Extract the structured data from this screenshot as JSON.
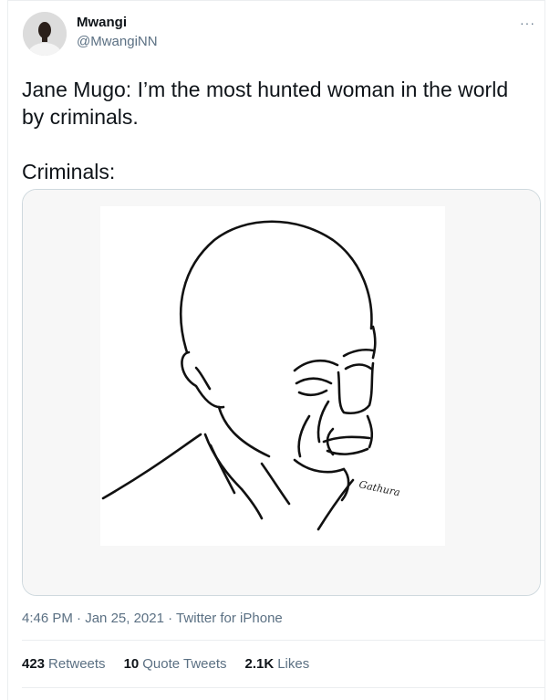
{
  "user": {
    "name": "Mwangi",
    "handle": "@MwangiNN"
  },
  "more_label": "···",
  "tweet": {
    "text": "Jane Mugo: I’m the most hunted woman in the world by criminals.\n\nCriminals:",
    "image_signature": "Gathura"
  },
  "meta": {
    "time": "4:46 PM",
    "sep1": " · ",
    "date": "Jan 25, 2021",
    "sep2": " · ",
    "source": "Twitter for iPhone"
  },
  "stats": {
    "retweets_count": "423",
    "retweets_label": "Retweets",
    "quotes_count": "10",
    "quotes_label": "Quote Tweets",
    "likes_count": "2.1K",
    "likes_label": "Likes"
  }
}
